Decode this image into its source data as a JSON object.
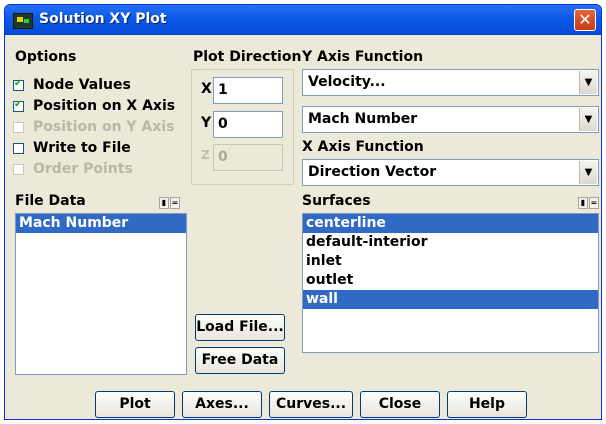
{
  "window": {
    "title": "Solution XY Plot",
    "close_glyph": "✕"
  },
  "options": {
    "label": "Options",
    "items": [
      {
        "label": "Node Values",
        "checked": true,
        "enabled": true
      },
      {
        "label": "Position on X Axis",
        "checked": true,
        "enabled": true
      },
      {
        "label": "Position on Y Axis",
        "checked": false,
        "enabled": false
      },
      {
        "label": "Write to File",
        "checked": false,
        "enabled": true
      },
      {
        "label": "Order Points",
        "checked": false,
        "enabled": false
      }
    ]
  },
  "plot_direction": {
    "label": "Plot Direction",
    "x_label": "X",
    "x_value": "1",
    "y_label": "Y",
    "y_value": "0",
    "z_label": "Z",
    "z_value": "0"
  },
  "y_axis_function": {
    "label": "Y Axis Function",
    "category": "Velocity...",
    "quantity": "Mach Number"
  },
  "x_axis_function": {
    "label": "X Axis Function",
    "value": "Direction Vector"
  },
  "file_data": {
    "label": "File Data",
    "items": [
      {
        "label": "Mach Number",
        "selected": true
      }
    ]
  },
  "surfaces": {
    "label": "Surfaces",
    "items": [
      {
        "label": "centerline",
        "selected": true
      },
      {
        "label": "default-interior",
        "selected": false
      },
      {
        "label": "inlet",
        "selected": false
      },
      {
        "label": "outlet",
        "selected": false
      },
      {
        "label": "wall",
        "selected": true
      }
    ]
  },
  "buttons": {
    "load_file": "Load File...",
    "free_data": "Free Data",
    "plot": "Plot",
    "axes": "Axes...",
    "curves": "Curves...",
    "close": "Close",
    "help": "Help"
  },
  "colors": {
    "selection": "#316ac5",
    "titlebar": "#0a5ae8",
    "close": "#e04b24"
  }
}
